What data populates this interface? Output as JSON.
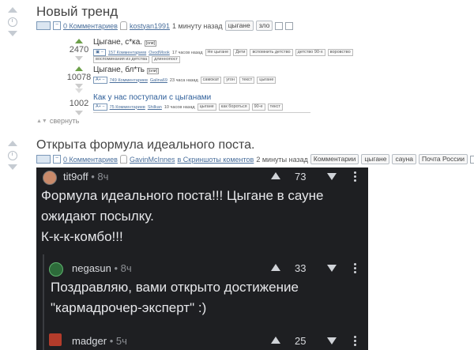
{
  "post1": {
    "title": "Новый тренд",
    "comments": "0 Комментариев",
    "author": "kostyan1991",
    "time": "1 минуту назад",
    "tags": [
      "цыгане",
      "зло"
    ],
    "sub_posts": [
      {
        "score": "2470",
        "title": "Цыгане, с*ка.",
        "badge": "[оли]",
        "comments": "157 Комментариев",
        "author": "OvodMook",
        "time": "17 часов назад",
        "tags_line1": [
          "Не цыгане",
          "Дети",
          "вспомнить детство",
          "детство 90-х",
          "воровство"
        ],
        "tags_line2": [
          "воспоминания из детства",
          "длиннопост"
        ]
      },
      {
        "score": "10078",
        "title": "Цыгане, бл*ть",
        "badge": "[оли]",
        "comments": "749 Комментариев",
        "author": "Galina69",
        "time": "23 часа назад",
        "tags_line1": [
          "самокат",
          "угон",
          "текст",
          "цыгане"
        ]
      },
      {
        "score": "1002",
        "title": "Как у нас поступали с цыганами",
        "comments": "75 Комментариев",
        "author": "Shilkan",
        "time": "10 часов назад",
        "tags_line1": [
          "цыгане",
          "как бороться",
          "90-е",
          "текст"
        ]
      }
    ],
    "collapse": "свернуть"
  },
  "post2": {
    "title": "Открыта формула идеального поста.",
    "comments": "0 Комментариев",
    "author": "GavinMcInnes",
    "community": "в Скриншоты коментов",
    "time": "2 минуты назад",
    "tags": [
      "Комментарии",
      "цыгане",
      "сауна",
      "Почта России"
    ]
  },
  "screenshot": {
    "comments": [
      {
        "user": "tit9off",
        "time": "• 8ч",
        "score": "73",
        "lines": [
          "Формула идеального поста!!! Цыгане в сауне",
          "ожидают посылку.",
          "К-к-к-комбо!!!"
        ]
      },
      {
        "user": "negasun",
        "time": "• 8ч",
        "score": "33",
        "lines": [
          "Поздравляю, вами открыто достижение",
          "\"кармадрочер-эксперт\" :)"
        ]
      },
      {
        "user": "madger",
        "time": "• 5ч",
        "score": "25",
        "lines": []
      }
    ]
  },
  "colors": {
    "link": "#4a6f9c",
    "dark_bg": "#1e1f22",
    "upvote_green": "#6da04a"
  }
}
